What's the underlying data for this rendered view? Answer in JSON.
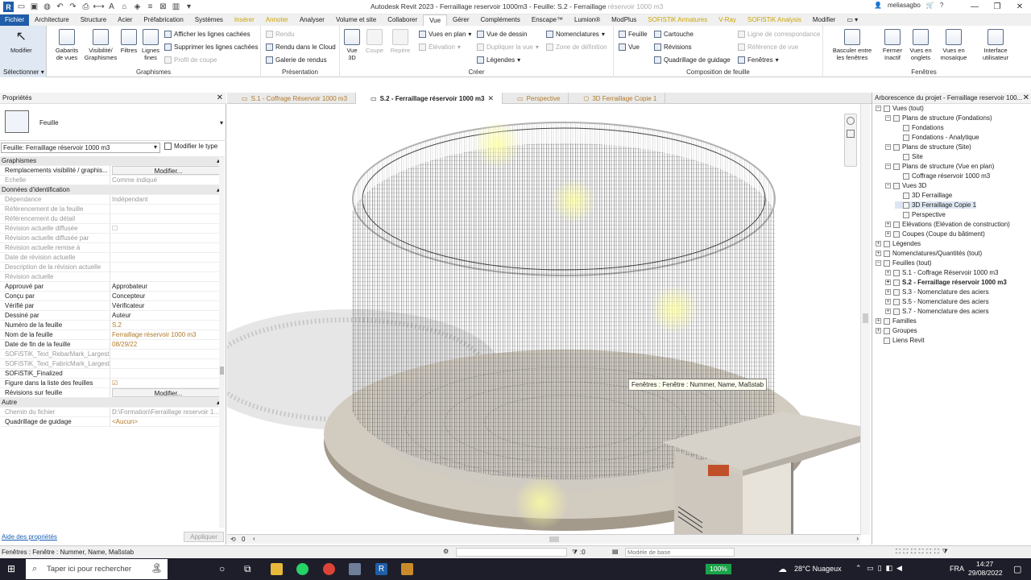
{
  "title": {
    "prefix": "Autodesk Revit 2023 - Ferraillage reservoir 1000m3 - Feuille: S.2 - Ferraillage ",
    "suffix": "réservoir 1000 m3",
    "user": "meliasagbo"
  },
  "tabs": [
    "Fichier",
    "Architecture",
    "Structure",
    "Acier",
    "Préfabrication",
    "Systèmes",
    "Insérer",
    "Annoter",
    "Analyser",
    "Volume et site",
    "Collaborer",
    "Vue",
    "Gérer",
    "Compléments",
    "Enscape™",
    "Lumion®",
    "ModPlus",
    "SOFiSTiK Armatures",
    "V-Ray",
    "SOFiSTiK Analysis",
    "Modifier"
  ],
  "ribbon": {
    "modifier": "Modifier",
    "selectionner": "Sélectionner",
    "graphismes": {
      "label": "Graphismes",
      "gabarits": "Gabarits de vues",
      "visibilite": "Visibilité/ Graphismes",
      "filtres": "Filtres",
      "lignes": "Lignes fines",
      "afficher": "Afficher les lignes cachées",
      "supprimer": "Supprimer les lignes cachées",
      "profil": "Profil de coupe"
    },
    "presentation": {
      "label": "Présentation",
      "rendu": "Rendu",
      "rendu_cloud": "Rendu  dans le Cloud",
      "galerie": "Galerie  de rendus"
    },
    "creer": {
      "label": "Créer",
      "vue3d": "Vue 3D",
      "coupe": "Coupe",
      "repere": "Repère",
      "vues_plan": "Vues en plan",
      "elevation": "Élévation",
      "vue_dessin": "Vue de dessin",
      "dupliquer": "Dupliquer la vue",
      "legendes": "Légendes",
      "nomenclatures": "Nomenclatures",
      "zone_def": "Zone de définition"
    },
    "composition": {
      "label": "Composition de feuille",
      "feuille": "Feuille",
      "vue": "Vue",
      "cartouche": "Cartouche",
      "revisions": "Révisions",
      "quadrillage": "Quadrillage de guidage",
      "fenetres": "Fenêtres",
      "ligne_corr": "Ligne de correspondance",
      "ref_vue": "Référence de vue"
    },
    "fenetres": {
      "label": "Fenêtres",
      "basculer": "Basculer entre les fenêtres",
      "fermer": "Fermer Inactif",
      "onglets": "Vues en onglets",
      "mosaique": "Vues en mosaïque",
      "interface": "Interface utilisateur"
    }
  },
  "properties": {
    "header": "Propriétés",
    "type": "Feuille",
    "filter": "Feuille: Ferraillage réservoir 1000 m3",
    "edit_type": "Modifier le type",
    "rows": [
      {
        "k": "Graphismes",
        "sec": true
      },
      {
        "k": "Remplacements visibilité / graphis...",
        "v": "Modifier...",
        "btn": true
      },
      {
        "k": "Echelle",
        "v": "Comme indiqué",
        "gray": true
      },
      {
        "k": "Données d'identification",
        "sec": true
      },
      {
        "k": "Dépendance",
        "v": "Indépendant",
        "gray": true
      },
      {
        "k": "Référencement de la feuille",
        "v": "",
        "gray": true
      },
      {
        "k": "Référencement du détail",
        "v": "",
        "gray": true
      },
      {
        "k": "Révision actuelle diffusée",
        "v": "☐",
        "gray": true
      },
      {
        "k": "Révision actuelle diffusée par",
        "v": "",
        "gray": true
      },
      {
        "k": "Révision actuelle remise à",
        "v": "",
        "gray": true
      },
      {
        "k": "Date de révision actuelle",
        "v": "",
        "gray": true
      },
      {
        "k": "Description de la révision actuelle",
        "v": "",
        "gray": true
      },
      {
        "k": "Révision actuelle",
        "v": "",
        "gray": true
      },
      {
        "k": "Approuvé par",
        "v": "Approbateur"
      },
      {
        "k": "Conçu par",
        "v": "Concepteur"
      },
      {
        "k": "Vérifié par",
        "v": "Vérificateur"
      },
      {
        "k": "Dessiné par",
        "v": "Auteur"
      },
      {
        "k": "Numéro de la feuille",
        "v": "S.2",
        "orange": true
      },
      {
        "k": "Nom de la feuille",
        "v": "Ferraillage réservoir 1000 m3",
        "orange": true
      },
      {
        "k": "Date de fin de la feuille",
        "v": "08/29/22",
        "orange": true
      },
      {
        "k": "SOFiSTiK_Text_RebarMark_Largest",
        "v": "",
        "gray": true
      },
      {
        "k": "SOFiSTiK_Text_FabricMark_Largest",
        "v": "",
        "gray": true
      },
      {
        "k": "SOFiSTiK_Finalized",
        "v": ""
      },
      {
        "k": "Figure dans la liste des feuilles",
        "v": "☑",
        "orange": true
      },
      {
        "k": "Révisions sur feuille",
        "v": "Modifier...",
        "btn": true
      },
      {
        "k": "Autre",
        "sec": true
      },
      {
        "k": "Chemin du fichier",
        "v": "D:\\Formation\\Ferraillage reservoir 1...",
        "gray": true
      },
      {
        "k": "Quadrillage de guidage",
        "v": "<Aucun>",
        "orange": true
      }
    ],
    "help": "Aide des propriétés",
    "apply": "Appliquer"
  },
  "doctabs": [
    {
      "label": "S.1 - Coffrage Réservoir 1000 m3",
      "active": false
    },
    {
      "label": "S.2 - Ferraillage réservoir 1000 m3",
      "active": true
    },
    {
      "label": "Perspective",
      "active": false
    },
    {
      "label": "3D Ferraillage Copie 1",
      "active": false
    }
  ],
  "tooltip": "Fenêtres : Fenêtre : Nummer, Name, Maßstab",
  "browser": {
    "header": "Arborescence du projet - Ferraillage reservoir 100...",
    "nodes": [
      {
        "t": "Vues (tout)",
        "l": 0,
        "tog": "−"
      },
      {
        "t": "Plans de structure (Fondations)",
        "l": 1,
        "tog": "−"
      },
      {
        "t": "Fondations",
        "l": 2
      },
      {
        "t": "Fondations - Analytique",
        "l": 2
      },
      {
        "t": "Plans de structure (Site)",
        "l": 1,
        "tog": "−"
      },
      {
        "t": "Site",
        "l": 2
      },
      {
        "t": "Plans de structure (Vue en plan)",
        "l": 1,
        "tog": "−"
      },
      {
        "t": "Coffrage réservoir 1000 m3",
        "l": 2
      },
      {
        "t": "Vues 3D",
        "l": 1,
        "tog": "−"
      },
      {
        "t": "3D Ferraillage",
        "l": 2
      },
      {
        "t": "3D Ferraillage Copie 1",
        "l": 2,
        "sel": true
      },
      {
        "t": "Perspective",
        "l": 2
      },
      {
        "t": "Elévations (Elévation de construction)",
        "l": 1,
        "tog": "+"
      },
      {
        "t": "Coupes (Coupe du bâtiment)",
        "l": 1,
        "tog": "+"
      },
      {
        "t": "Légendes",
        "l": 0,
        "tog": "+"
      },
      {
        "t": "Nomenclatures/Quantités (tout)",
        "l": 0,
        "tog": "+"
      },
      {
        "t": "Feuilles (tout)",
        "l": 0,
        "tog": "−"
      },
      {
        "t": "S.1 - Coffrage Réservoir 1000 m3",
        "l": 1,
        "tog": "+"
      },
      {
        "t": "S.2 - Ferraillage réservoir 1000 m3",
        "l": 1,
        "tog": "+",
        "bold": true
      },
      {
        "t": "S.3 - Nomenclature des aciers",
        "l": 1,
        "tog": "+"
      },
      {
        "t": "S.5 - Nomenclature des aciers",
        "l": 1,
        "tog": "+"
      },
      {
        "t": "S.7 - Nomenclature des aciers",
        "l": 1,
        "tog": "+"
      },
      {
        "t": "Familles",
        "l": 0,
        "tog": "+"
      },
      {
        "t": "Groupes",
        "l": 0,
        "tog": "+"
      },
      {
        "t": "Liens Revit",
        "l": 0
      }
    ]
  },
  "viewbar": {
    "zero": "0"
  },
  "status": {
    "text": "Fenêtres : Fenêtre : Nummer, Name, Maßstab",
    "count": ":0",
    "model": "Modèle de base"
  },
  "taskbar": {
    "search": "Taper ici pour rechercher",
    "battery": "100%",
    "weather": "28°C  Nuageux",
    "lang": "FRA",
    "time": "14:27",
    "date": "29/08/2022"
  },
  "colors": {
    "file_tab": "#1f5ea8",
    "accent_orange": "#b07a2a",
    "taskbar": "#1e1e2a"
  }
}
